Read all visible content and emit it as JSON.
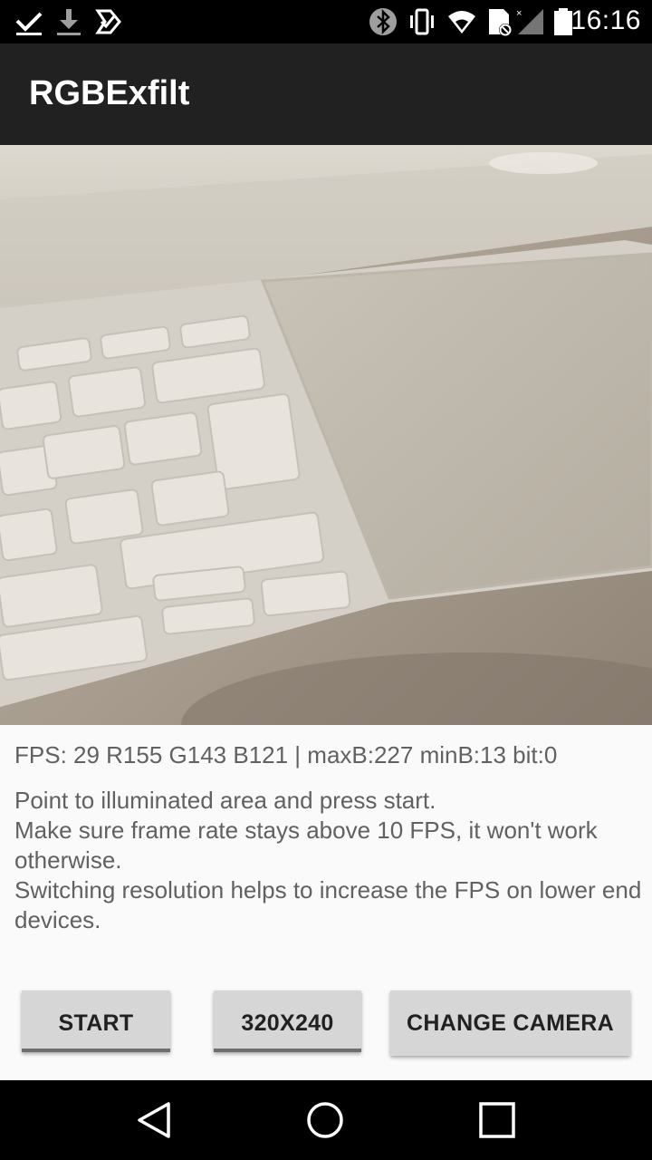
{
  "status_bar": {
    "time": "16:16",
    "left_icons": [
      "checkmark-notification-icon",
      "download-icon",
      "task-done-icon"
    ],
    "right_icons": [
      "bluetooth-icon",
      "vibrate-icon",
      "wifi-icon",
      "data-off-icon",
      "signal-icon",
      "battery-icon"
    ]
  },
  "app_bar": {
    "title": "RGBExfilt"
  },
  "camera": {
    "subject": "camera-preview"
  },
  "stats": {
    "fps_line": "FPS: 29 R155 G143 B121 | maxB:227 minB:13 bit:0"
  },
  "instructions": {
    "line1": "Point to illuminated area and press start.",
    "line2": "Make sure frame rate stays above 10 FPS, it won't work otherwise.",
    "line3": "Switching resolution helps to increase the FPS on lower end devices."
  },
  "buttons": {
    "start": "START",
    "resolution": "320X240",
    "change_camera": "CHANGE CAMERA"
  },
  "nav_bar": {
    "icons": [
      "back-icon",
      "home-icon",
      "recents-icon"
    ]
  }
}
